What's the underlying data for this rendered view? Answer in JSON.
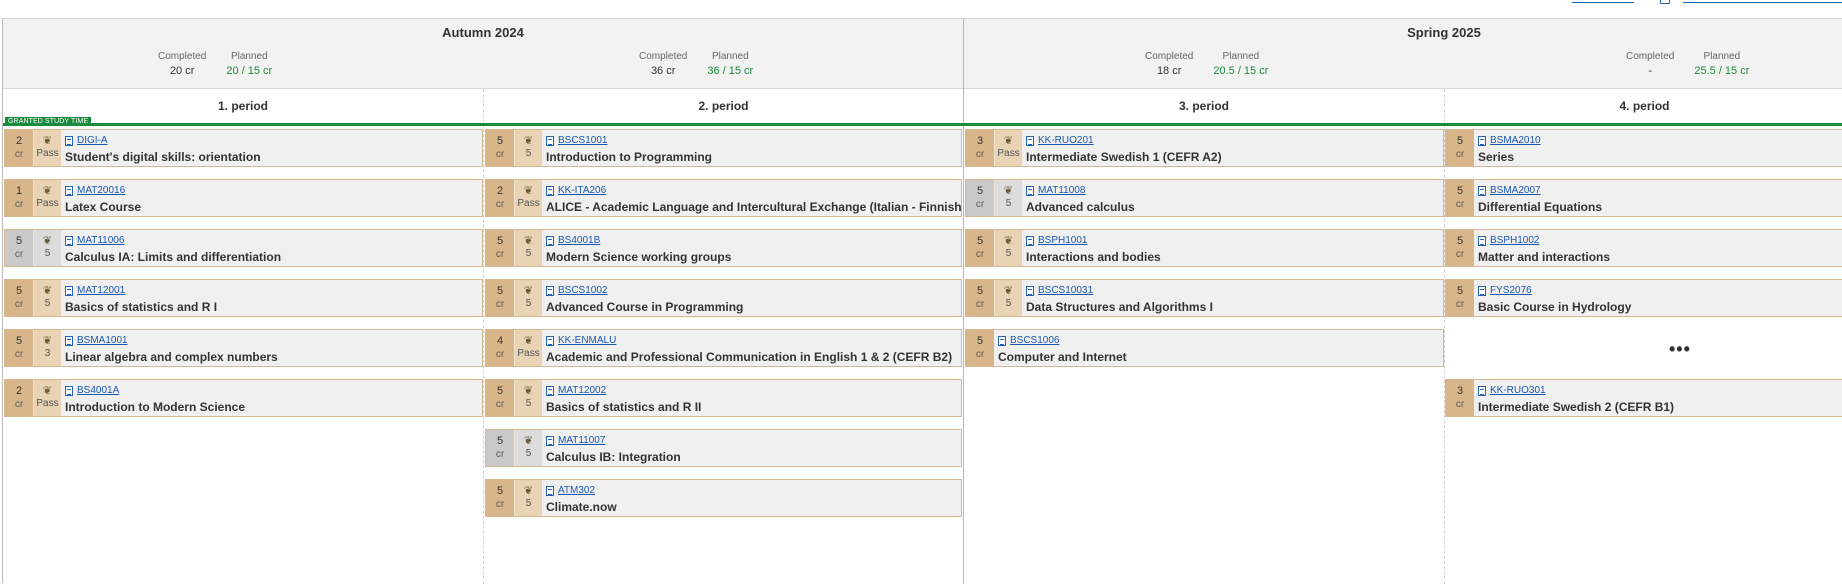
{
  "granted_label": "GRANTED STUDY TIME",
  "terms": [
    {
      "title": "Autumn 2024",
      "periods": [
        {
          "title": "1. period",
          "completed_label": "Completed",
          "completed": "20 cr",
          "planned_label": "Planned",
          "planned": "20 / 15 cr",
          "courses": [
            {
              "credits": "2",
              "unit": "cr",
              "grade": "Pass",
              "code": "DIGI-A",
              "name": "Student's digital skills: orientation",
              "crgray": false
            },
            {
              "credits": "1",
              "unit": "cr",
              "grade": "Pass",
              "code": "MAT20016",
              "name": "Latex Course",
              "crgray": false
            },
            {
              "credits": "5",
              "unit": "cr",
              "grade": "5",
              "code": "MAT11006",
              "name": "Calculus IA: Limits and differentiation",
              "crgray": true
            },
            {
              "credits": "5",
              "unit": "cr",
              "grade": "5",
              "code": "MAT12001",
              "name": "Basics of statistics and R I",
              "crgray": false
            },
            {
              "credits": "5",
              "unit": "cr",
              "grade": "3",
              "code": "BSMA1001",
              "name": "Linear algebra and complex numbers",
              "crgray": false
            },
            {
              "credits": "2",
              "unit": "cr",
              "grade": "Pass",
              "code": "BS4001A",
              "name": "Introduction to Modern Science",
              "crgray": false
            }
          ]
        },
        {
          "title": "2. period",
          "completed_label": "Completed",
          "completed": "36 cr",
          "planned_label": "Planned",
          "planned": "36 / 15 cr",
          "courses": [
            {
              "credits": "5",
              "unit": "cr",
              "grade": "5",
              "code": "BSCS1001",
              "name": "Introduction to Programming",
              "crgray": false
            },
            {
              "credits": "2",
              "unit": "cr",
              "grade": "Pass",
              "code": "KK-ITA206",
              "name": "ALICE - Academic Language and Intercultural Exchange (Italian - Finnish/Swe",
              "crgray": false
            },
            {
              "credits": "5",
              "unit": "cr",
              "grade": "5",
              "code": "BS4001B",
              "name": "Modern Science working groups",
              "crgray": false
            },
            {
              "credits": "5",
              "unit": "cr",
              "grade": "5",
              "code": "BSCS1002",
              "name": "Advanced Course in Programming",
              "crgray": false
            },
            {
              "credits": "4",
              "unit": "cr",
              "grade": "Pass",
              "code": "KK-ENMALU",
              "name": "Academic and Professional Communication in English 1 & 2 (CEFR B2)",
              "crgray": false
            },
            {
              "credits": "5",
              "unit": "cr",
              "grade": "5",
              "code": "MAT12002",
              "name": "Basics of statistics and R II",
              "crgray": false
            },
            {
              "credits": "5",
              "unit": "cr",
              "grade": "5",
              "code": "MAT11007",
              "name": "Calculus IB: Integration",
              "crgray": true
            },
            {
              "credits": "5",
              "unit": "cr",
              "grade": "5",
              "code": "ATM302",
              "name": "Climate.now",
              "crgray": false
            }
          ]
        }
      ]
    },
    {
      "title": "Spring 2025",
      "periods": [
        {
          "title": "3. period",
          "completed_label": "Completed",
          "completed": "18 cr",
          "planned_label": "Planned",
          "planned": "20.5 / 15 cr",
          "courses": [
            {
              "credits": "3",
              "unit": "cr",
              "grade": "Pass",
              "code": "KK-RUO201",
              "name": "Intermediate Swedish 1 (CEFR A2)",
              "crgray": false
            },
            {
              "credits": "5",
              "unit": "cr",
              "grade": "5",
              "code": "MAT11008",
              "name": "Advanced calculus",
              "crgray": true
            },
            {
              "credits": "5",
              "unit": "cr",
              "grade": "5",
              "code": "BSPH1001",
              "name": "Interactions and bodies",
              "crgray": false
            },
            {
              "credits": "5",
              "unit": "cr",
              "grade": "5",
              "code": "BSCS10031",
              "name": "Data Structures and Algorithms I",
              "crgray": false
            },
            {
              "credits": "5",
              "unit": "cr",
              "grade": null,
              "code": "BSCS1006",
              "name": "Computer and Internet",
              "crgray": false
            }
          ]
        },
        {
          "title": "4. period",
          "completed_label": "Completed",
          "completed": "-",
          "planned_label": "Planned",
          "planned": "25.5 / 15 cr",
          "more_label": "•••",
          "courses": [
            {
              "credits": "5",
              "unit": "cr",
              "grade": null,
              "code": "BSMA2010",
              "name": "Series",
              "crgray": false
            },
            {
              "credits": "5",
              "unit": "cr",
              "grade": null,
              "code": "BSMA2007",
              "name": "Differential Equations",
              "crgray": false
            },
            {
              "credits": "5",
              "unit": "cr",
              "grade": null,
              "code": "BSPH1002",
              "name": "Matter and interactions",
              "crgray": false
            },
            {
              "credits": "5",
              "unit": "cr",
              "grade": null,
              "code": "FYS2076",
              "name": "Basic Course in Hydrology",
              "crgray": false
            },
            {
              "credits": "3",
              "unit": "cr",
              "grade": null,
              "code": "KK-RUO301",
              "name": "Intermediate Swedish 2 (CEFR B1)",
              "crgray": false
            }
          ]
        }
      ]
    }
  ]
}
